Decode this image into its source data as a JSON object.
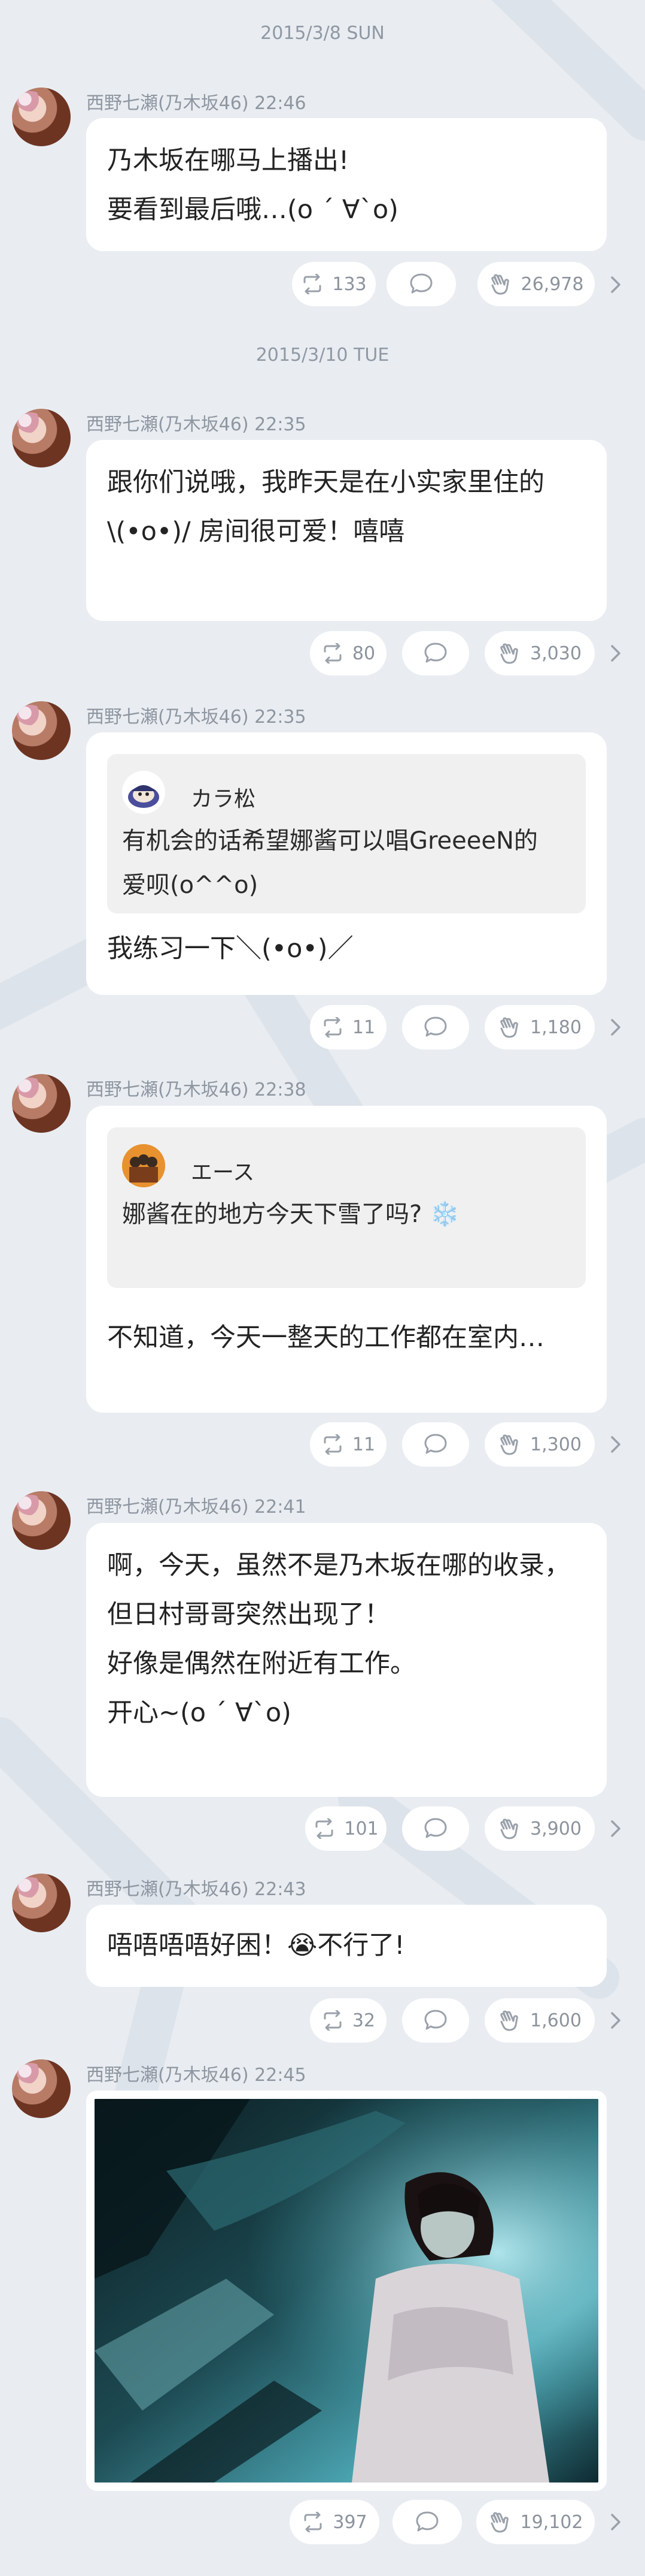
{
  "colors": {
    "background": "#e9edf2",
    "bubble": "#ffffff",
    "meta_text": "#8e96a0",
    "quote_bg": "#f0f0f1"
  },
  "posts": [
    {
      "date": "2015/3/8 SUN",
      "author": "西野七瀬(乃木坂46)",
      "time": "22:46",
      "lines": [
        "乃木坂在哪马上播出!",
        "要看到最后哦…(o ´ ∀`o)"
      ],
      "repost": "133",
      "likes": "26,978"
    },
    {
      "date": "2015/3/10 TUE",
      "author": "西野七瀬(乃木坂46)",
      "time": "22:35",
      "lines": [
        "跟你们说哦，我昨天是在小实家里住的",
        "\\(•o•)/ 房间很可爱！嘻嘻"
      ],
      "repost": "80",
      "likes": "3,030"
    },
    {
      "author": "西野七瀬(乃木坂46)",
      "time": "22:35",
      "quote": {
        "name": "カラ松",
        "lines": [
          "有机会的话希望娜酱可以唱GreeeeN的",
          "爱呗(o^^o)"
        ]
      },
      "lines": [
        "我练习一下＼(•o•)／"
      ],
      "repost": "11",
      "likes": "1,180"
    },
    {
      "author": "西野七瀬(乃木坂46)",
      "time": "22:38",
      "quote": {
        "name": "エース",
        "lines": [
          "娜酱在的地方今天下雪了吗? ❄️"
        ]
      },
      "lines": [
        "不知道，今天一整天的工作都在室内…"
      ],
      "repost": "11",
      "likes": "1,300"
    },
    {
      "author": "西野七瀬(乃木坂46)",
      "time": "22:41",
      "lines": [
        "啊，今天，虽然不是乃木坂在哪的收录，",
        "但日村哥哥突然出现了！",
        "好像是偶然在附近有工作。",
        "开心~(o ´ ∀`o)"
      ],
      "repost": "101",
      "likes": "3,900"
    },
    {
      "author": "西野七瀬(乃木坂46)",
      "time": "22:43",
      "lines": [
        "唔唔唔唔好困！😭不行了!"
      ],
      "repost": "32",
      "likes": "1,600"
    },
    {
      "author": "西野七瀬(乃木坂46)",
      "time": "22:45",
      "photo": true,
      "repost": "397",
      "likes": "19,102"
    }
  ],
  "icons": {
    "repost": "repost-icon",
    "comment": "comment-icon",
    "like": "clap-icon",
    "more": "chevron-right-icon"
  }
}
